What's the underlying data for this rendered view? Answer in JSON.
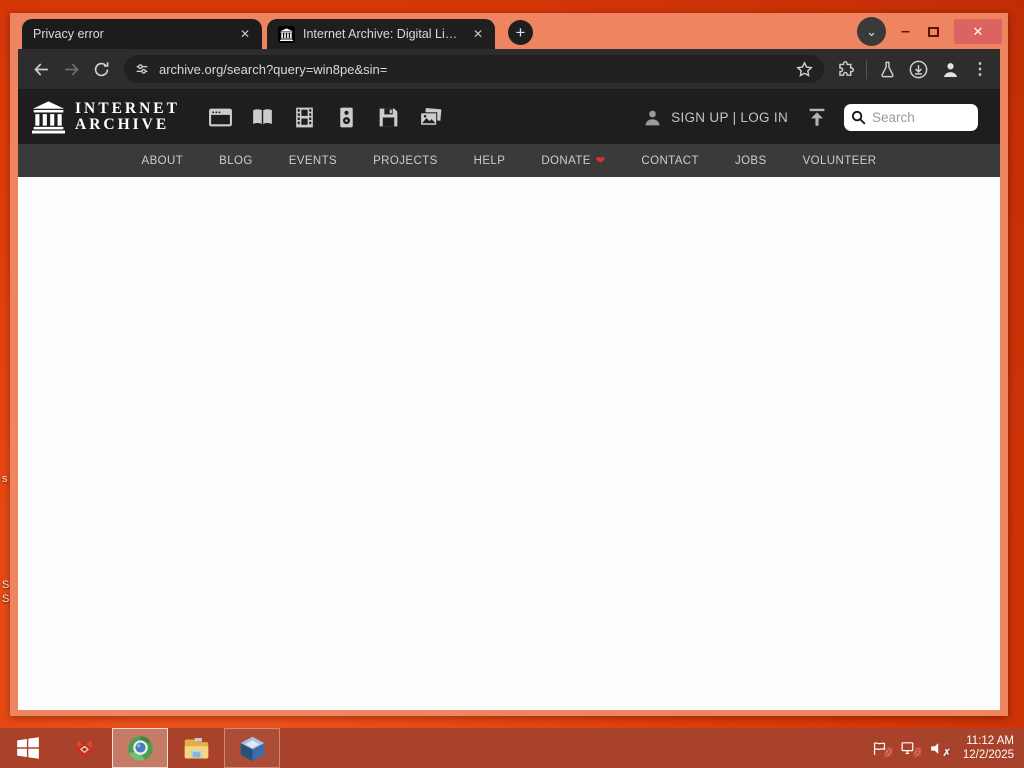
{
  "window": {
    "tabs": [
      {
        "title": "Privacy error"
      },
      {
        "title": "Internet Archive: Digital Library"
      }
    ],
    "new_tab_glyph": "+",
    "controls_icons": [
      "chevron-down-icon",
      "minimize-icon",
      "maximize-icon",
      "close-icon"
    ]
  },
  "browser": {
    "url": "archive.org/search?query=win8pe&sin=",
    "toolbar_icons": [
      "back-icon",
      "forward-icon",
      "reload-icon",
      "site-settings-icon",
      "bookmark-star-icon",
      "extensions-icon",
      "lab-flask-icon",
      "download-icon",
      "profile-icon",
      "menu-dots-icon"
    ]
  },
  "ia": {
    "logo": [
      "INTERNET",
      "ARCHIVE"
    ],
    "media_icons": [
      "web",
      "texts",
      "video",
      "audio",
      "software",
      "images"
    ],
    "auth_label": "SIGN UP | LOG IN",
    "search_placeholder": "Search",
    "nav": [
      "ABOUT",
      "BLOG",
      "EVENTS",
      "PROJECTS",
      "HELP",
      "DONATE",
      "CONTACT",
      "JOBS",
      "VOLUNTEER"
    ]
  },
  "taskbar": {
    "time": "11:12 AM",
    "date": "12/2/2025",
    "apps": [
      "start",
      "red-app",
      "chrome",
      "file-explorer",
      "virtualbox"
    ],
    "tray_icons": [
      "action-center-flag",
      "network-disconnected",
      "volume-muted"
    ]
  },
  "desktop": {
    "fragments": [
      "s",
      "S",
      "S"
    ]
  },
  "colors": {
    "desktop": "#e23d0a",
    "window_frame": "#ee8560",
    "taskbar": "#a8422a",
    "close_button": "#db6360",
    "donate_heart": "#e0312e",
    "ia_header": "#201d1d",
    "ia_nav": "#3a3a3a",
    "toolbar": "#2d2d2d"
  }
}
